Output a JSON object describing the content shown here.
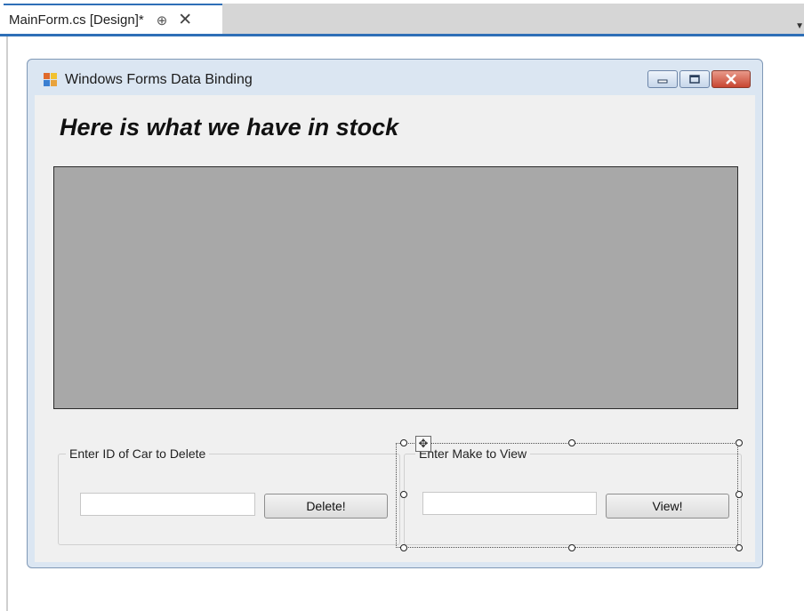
{
  "ide": {
    "tab_title": "MainForm.cs [Design]*",
    "pin_glyph": "⊕",
    "close_glyph": "✕",
    "accent_color": "#2e6fb7"
  },
  "form": {
    "title": "Windows Forms Data Binding",
    "heading": "Here is what we have in stock",
    "grid_color": "#a8a8a8",
    "delete_group": {
      "label": "Enter ID of Car to Delete",
      "input_value": "",
      "button_label": "Delete!"
    },
    "view_group": {
      "label": "Enter Make to View",
      "input_value": "",
      "button_label": "View!"
    }
  },
  "icons": [
    "pin-icon",
    "close-icon",
    "app-icon",
    "minimize-icon",
    "maximize-icon",
    "window-close-icon",
    "move-icon"
  ]
}
